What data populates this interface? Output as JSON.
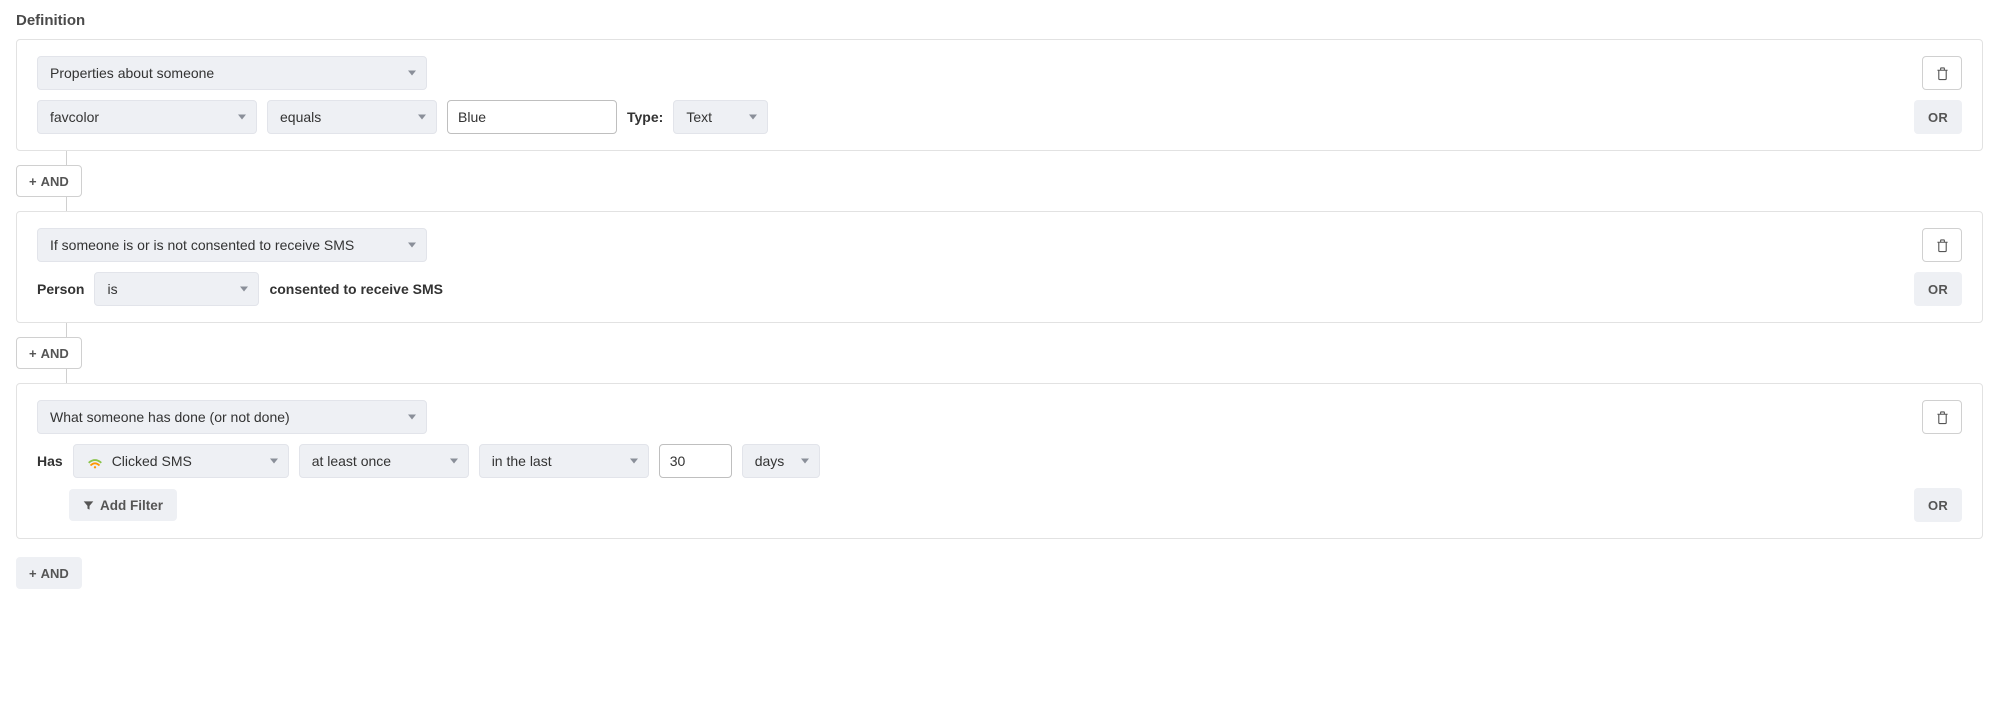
{
  "heading": "Definition",
  "buttons": {
    "and": "AND",
    "or": "OR",
    "add_filter": "Add Filter"
  },
  "labels": {
    "type": "Type:",
    "person": "Person",
    "consented_suffix": "consented to receive SMS",
    "has": "Has"
  },
  "conditions": [
    {
      "category": "Properties about someone",
      "property": "favcolor",
      "operator": "equals",
      "value": "Blue",
      "value_type": "Text"
    },
    {
      "category": "If someone is or is not consented to receive SMS",
      "verb": "is"
    },
    {
      "category": "What someone has done (or not done)",
      "event": "Clicked SMS",
      "frequency": "at least once",
      "timeframe": "in the last",
      "time_value": "30",
      "time_unit": "days"
    }
  ]
}
